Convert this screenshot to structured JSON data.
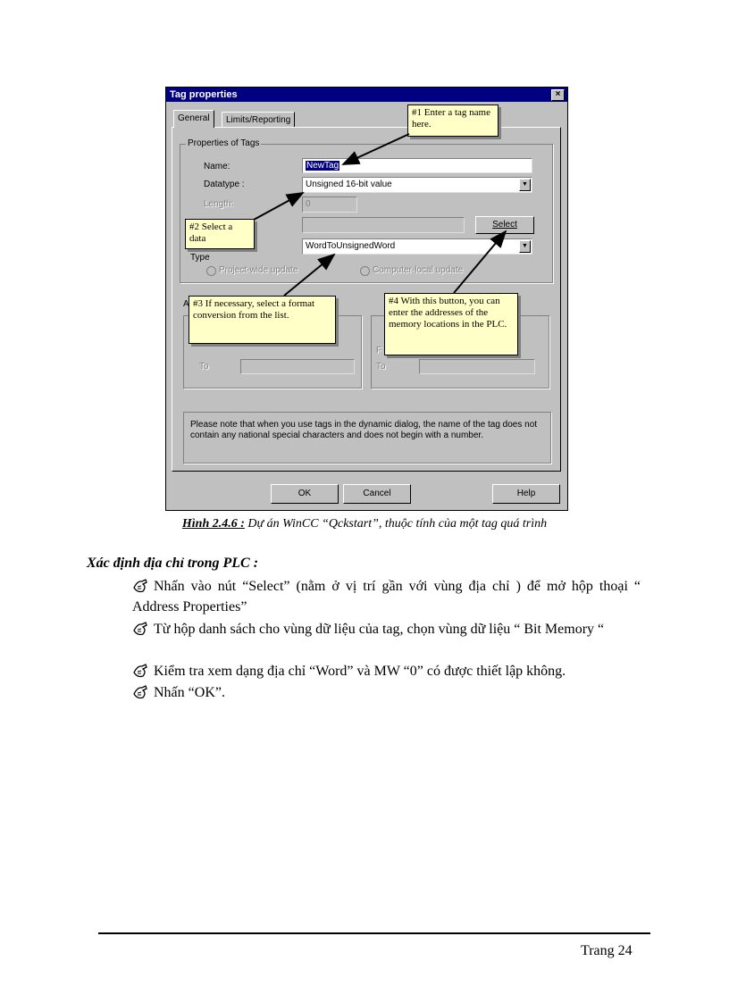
{
  "dialog": {
    "title": "Tag properties",
    "close_glyph": "×",
    "tabs": [
      "General",
      "Limits/Reporting"
    ],
    "group_properties": "Properties of Tags",
    "name_label": "Name:",
    "name_value": "NewTag",
    "datatype_label": "Datatype :",
    "datatype_value": "Unsigned 16-bit value",
    "length_label": "Length:",
    "length_value": "0",
    "select_button": "Select",
    "conversion_value": "WordToUnsignedWord",
    "type_label": "Type",
    "radio_project": "Project-wide update",
    "radio_computer": "Computer-local update",
    "adapt_format": "A",
    "range_from_1": "F",
    "range_to_1": "To",
    "range_from_2": "F",
    "range_to_2": "To",
    "note": "Please note that when you use tags in the dynamic dialog, the name of the tag does not contain any national special characters and does not begin with a number.",
    "ok_button": "OK",
    "cancel_button": "Cancel",
    "help_button": "Help",
    "callout1": "#1 Enter a tag name here.",
    "callout2": "#2 Select a data",
    "callout3": "#3 If necessary, select a format conversion from the list.",
    "callout4": "#4 With this button, you can enter the addresses of the memory locations in the PLC."
  },
  "caption": {
    "label": "Hình 2.4.6 :",
    "text": " Dự án WinCC “Qckstart”, thuộc tính của một tag quá trình"
  },
  "section_title": "Xác định địa chỉ trong PLC :",
  "steps": [
    "Nhấn vào nút “Select” (nằm ở vị trí gần với vùng địa chỉ ) để mở hộp thoại “ Address Properties”",
    "Từ hộp danh sách cho vùng dữ liệu của tag, chọn vùng dữ liệu “ Bit Memory “",
    "Kiểm tra xem dạng địa chỉ “Word” và MW “0” có được thiết lập không.",
    "Nhấn “OK”."
  ],
  "page_number": "Trang 24"
}
